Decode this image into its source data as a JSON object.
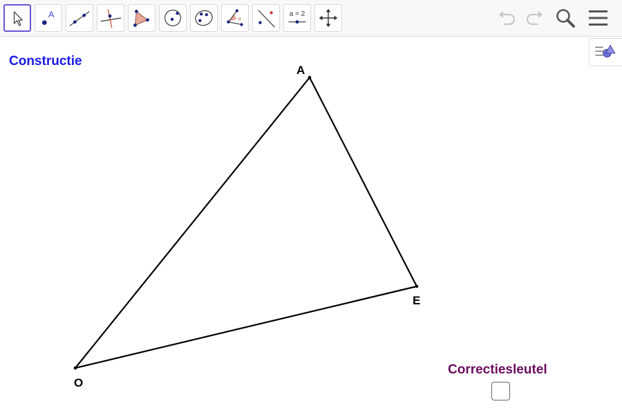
{
  "toolbar": {
    "tools": [
      {
        "name": "move",
        "selected": true
      },
      {
        "name": "point"
      },
      {
        "name": "line"
      },
      {
        "name": "perpendicular-line"
      },
      {
        "name": "polygon"
      },
      {
        "name": "circle-center-point"
      },
      {
        "name": "ellipse"
      },
      {
        "name": "angle"
      },
      {
        "name": "reflect"
      },
      {
        "name": "slider",
        "label": "a = 2"
      },
      {
        "name": "move-graphics-view"
      }
    ],
    "point_tool_label": "A",
    "slider_label": "a = 2",
    "icons": [
      "undo-icon",
      "redo-icon",
      "search-icon",
      "menu-icon"
    ]
  },
  "canvas": {
    "title": "Constructie",
    "title_color": "#1a1ae6",
    "points": [
      {
        "name": "A",
        "label": "A"
      },
      {
        "name": "E",
        "label": "E"
      },
      {
        "name": "O",
        "label": "O"
      }
    ],
    "correction_label": "Correctiesleutel",
    "correction_color": "#6b0c5e",
    "correction_checked": false
  },
  "colors": {
    "accent": "#6557d2",
    "point": "#1a237e"
  }
}
